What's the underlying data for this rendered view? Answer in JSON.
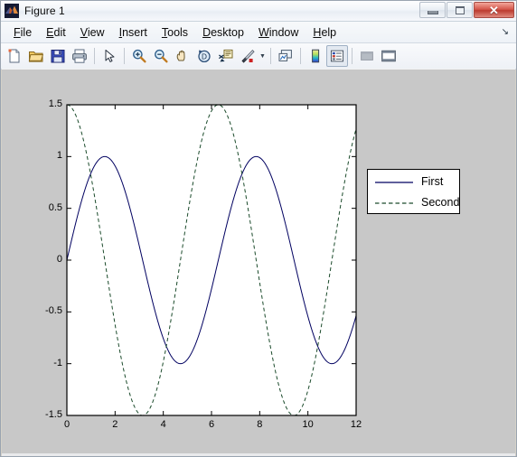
{
  "window": {
    "title": "Figure 1",
    "logo_icon": "matlab-membrane-logo",
    "buttons": [
      {
        "name": "minimize",
        "icon": "minimize-icon",
        "label": ""
      },
      {
        "name": "maximize",
        "icon": "maximize-icon",
        "label": ""
      },
      {
        "name": "close",
        "icon": "close-icon",
        "label": "✕"
      }
    ]
  },
  "menubar": {
    "items": [
      {
        "label": "File",
        "mnemonic": "F"
      },
      {
        "label": "Edit",
        "mnemonic": "E"
      },
      {
        "label": "View",
        "mnemonic": "V"
      },
      {
        "label": "Insert",
        "mnemonic": "I"
      },
      {
        "label": "Tools",
        "mnemonic": "T"
      },
      {
        "label": "Desktop",
        "mnemonic": "D"
      },
      {
        "label": "Window",
        "mnemonic": "W"
      },
      {
        "label": "Help",
        "mnemonic": "H"
      }
    ],
    "overflow_glyph": "↘"
  },
  "toolbar": {
    "items": [
      {
        "icon": "new-figure-icon",
        "tooltip": "New Figure"
      },
      {
        "icon": "open-folder-icon",
        "tooltip": "Open File"
      },
      {
        "icon": "save-icon",
        "tooltip": "Save Figure"
      },
      {
        "icon": "print-icon",
        "tooltip": "Print Figure"
      },
      {
        "icon": "separator",
        "tooltip": ""
      },
      {
        "icon": "pointer-arrow-icon",
        "tooltip": "Edit Plot"
      },
      {
        "icon": "separator",
        "tooltip": ""
      },
      {
        "icon": "zoom-in-icon",
        "tooltip": "Zoom In"
      },
      {
        "icon": "zoom-out-icon",
        "tooltip": "Zoom Out"
      },
      {
        "icon": "pan-hand-icon",
        "tooltip": "Pan"
      },
      {
        "icon": "rotate-3d-icon",
        "tooltip": "Rotate 3D"
      },
      {
        "icon": "data-cursor-icon",
        "tooltip": "Data Cursor"
      },
      {
        "icon": "brush-icon",
        "tooltip": "Brush/Select Data"
      },
      {
        "icon": "dropdown-caret",
        "tooltip": ""
      },
      {
        "icon": "separator",
        "tooltip": ""
      },
      {
        "icon": "link-plot-icon",
        "tooltip": "Link Plot"
      },
      {
        "icon": "separator",
        "tooltip": ""
      },
      {
        "icon": "colorbar-icon",
        "tooltip": "Insert Colorbar"
      },
      {
        "icon": "legend-icon",
        "tooltip": "Insert Legend",
        "state": "pressed"
      },
      {
        "icon": "separator",
        "tooltip": ""
      },
      {
        "icon": "hide-plot-tools-icon",
        "tooltip": "Hide Plot Tools",
        "state": "disabled"
      },
      {
        "icon": "show-plot-tools-icon",
        "tooltip": "Show Plot Tools"
      }
    ]
  },
  "chart_data": {
    "type": "line",
    "title": "",
    "xlabel": "",
    "ylabel": "",
    "xlim": [
      0,
      12
    ],
    "ylim": [
      -1.5,
      1.5
    ],
    "xticks": [
      0,
      2,
      4,
      6,
      8,
      10,
      12
    ],
    "yticks": [
      -1.5,
      -1,
      -0.5,
      0,
      0.5,
      1,
      1.5
    ],
    "xtick_labels": [
      "0",
      "2",
      "4",
      "6",
      "8",
      "10",
      "12"
    ],
    "ytick_labels": [
      "-1.5",
      "-1",
      "-0.5",
      "0",
      "0.5",
      "1",
      "1.5"
    ],
    "grid": false,
    "box": true,
    "background": "#ffffff",
    "figure_background": "#c8c8c8",
    "legend": {
      "position": "north-east-outside",
      "entries": [
        "First",
        "Second"
      ],
      "box": true
    },
    "series": [
      {
        "name": "First",
        "expression": "sin(x)",
        "amplitude": 1.0,
        "color": "#000060",
        "linestyle": "solid",
        "linewidth": 1
      },
      {
        "name": "Second",
        "expression": "1.5*cos(x)",
        "amplitude": 1.5,
        "color": "#1a4a2a",
        "linestyle": "dashed",
        "linewidth": 1
      }
    ]
  }
}
